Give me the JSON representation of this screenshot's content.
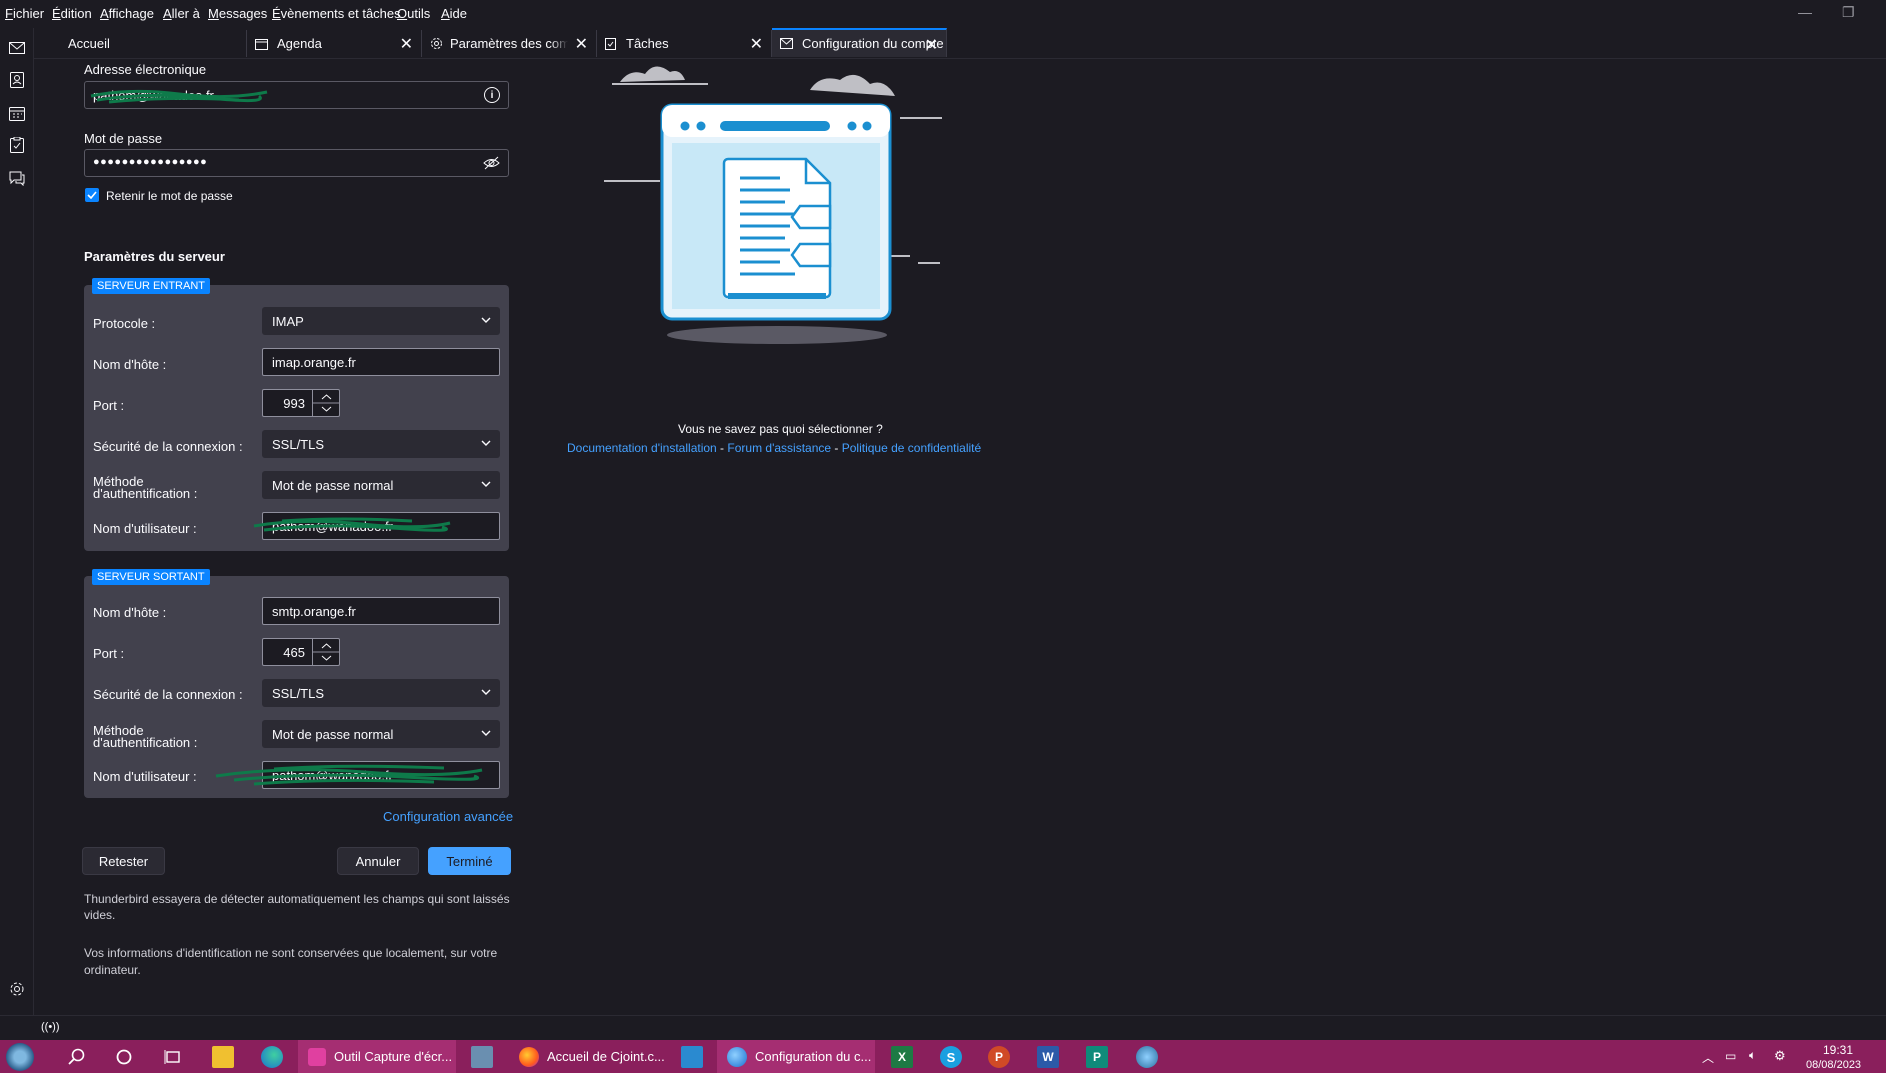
{
  "menubar": {
    "items": [
      "Fichier",
      "Édition",
      "Affichage",
      "Aller à",
      "Messages",
      "Évènements et tâches",
      "Outils",
      "Aide"
    ]
  },
  "tabs": [
    {
      "label": "Accueil"
    },
    {
      "label": "Agenda"
    },
    {
      "label": "Paramètres des comptes Co"
    },
    {
      "label": "Tâches"
    },
    {
      "label": "Configuration du compte"
    }
  ],
  "form": {
    "email_label": "Adresse électronique",
    "email_value": "pathom@wanadoo.fr",
    "password_label": "Mot de passe",
    "password_value": "●●●●●●●●●●●●●●●●",
    "remember_label": "Retenir le mot de passe",
    "remember_checked": true,
    "server_settings_title": "Paramètres du serveur"
  },
  "incoming": {
    "badge": "SERVEUR ENTRANT",
    "protocol_label": "Protocole :",
    "protocol_value": "IMAP",
    "hostname_label": "Nom d'hôte :",
    "hostname_value": "imap.orange.fr",
    "port_label": "Port :",
    "port_value": "993",
    "security_label": "Sécurité de la connexion :",
    "security_value": "SSL/TLS",
    "auth_label_1": "Méthode",
    "auth_label_2": "d'authentification :",
    "auth_value": "Mot de passe normal",
    "username_label": "Nom d'utilisateur :",
    "username_value": "pathom@wanadoo.fr"
  },
  "outgoing": {
    "badge": "SERVEUR SORTANT",
    "hostname_label": "Nom d'hôte :",
    "hostname_value": "smtp.orange.fr",
    "port_label": "Port :",
    "port_value": "465",
    "security_label": "Sécurité de la connexion :",
    "security_value": "SSL/TLS",
    "auth_label_1": "Méthode",
    "auth_label_2": "d'authentification :",
    "auth_value": "Mot de passe normal",
    "username_label": "Nom d'utilisateur :",
    "username_value": "pathom@wanadoo.fr"
  },
  "actions": {
    "advanced_link": "Configuration avancée",
    "retest": "Retester",
    "cancel": "Annuler",
    "done": "Terminé"
  },
  "notes": {
    "autodetect": "Thunderbird essayera de détecter automatiquement les champs qui sont laissés vides.",
    "local_creds": "Vos informations d'identification ne sont conservées que localement, sur votre ordinateur."
  },
  "help": {
    "question": "Vous ne savez pas quoi sélectionner ?",
    "doc_link": "Documentation d'installation",
    "sep1": " - ",
    "forum_link": "Forum d'assistance",
    "sep2": " - ",
    "privacy_link": "Politique de confidentialité"
  },
  "taskbar": {
    "app1": "Outil Capture d'écr...",
    "app2": "Accueil de Cjoint.c...",
    "app3": "Configuration du c...",
    "time": "19:31",
    "date": "08/08/2023"
  },
  "colors": {
    "accent": "#0a84ff",
    "link": "#45a1ff",
    "background": "#1c1b22",
    "panel": "#42414d",
    "taskbar": "#8a1f5c"
  }
}
